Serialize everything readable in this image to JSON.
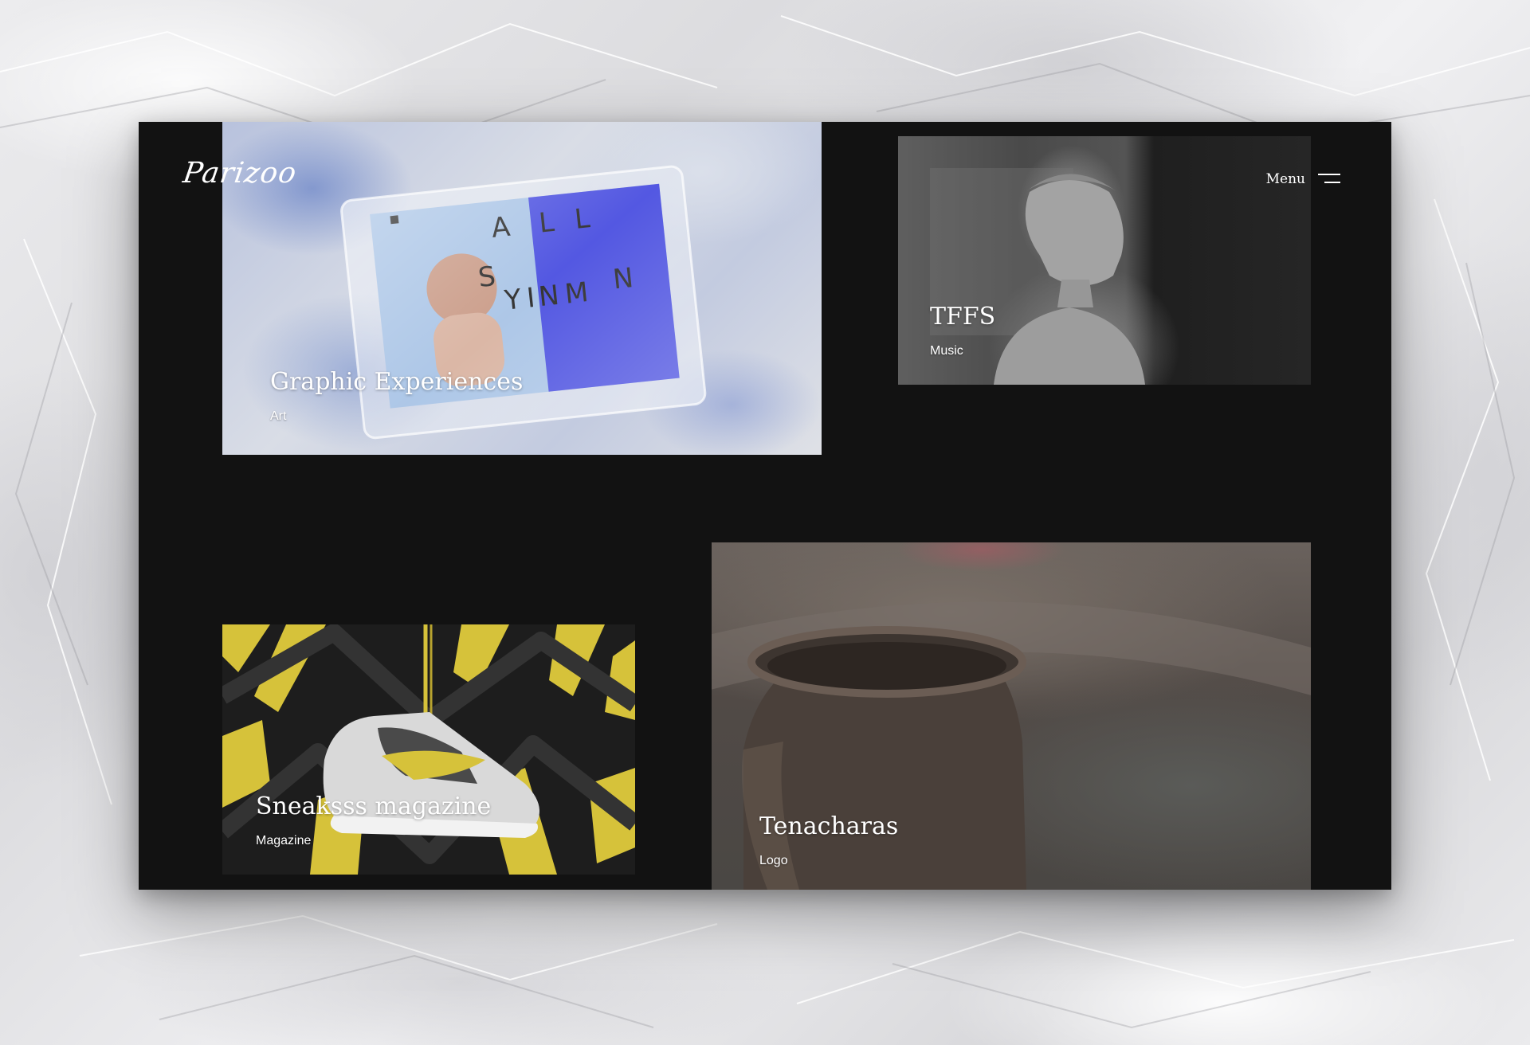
{
  "brand": {
    "logo_text": "Parizoo"
  },
  "header": {
    "menu_label": "Menu",
    "menu_icon": "hamburger-menu-icon"
  },
  "projects": [
    {
      "title": "Graphic Experiences",
      "category": "Art"
    },
    {
      "title": "TFFS",
      "category": "Music"
    },
    {
      "title": "Sneaksss magazine",
      "category": "Magazine"
    },
    {
      "title": "Tenacharas",
      "category": "Logo"
    }
  ],
  "colors": {
    "page_background": "#e6e6e8",
    "window_background": "#121212",
    "text": "#ffffff",
    "poster_blue": "#4a4fe0",
    "sneaker_yellow": "#d6c23a"
  }
}
